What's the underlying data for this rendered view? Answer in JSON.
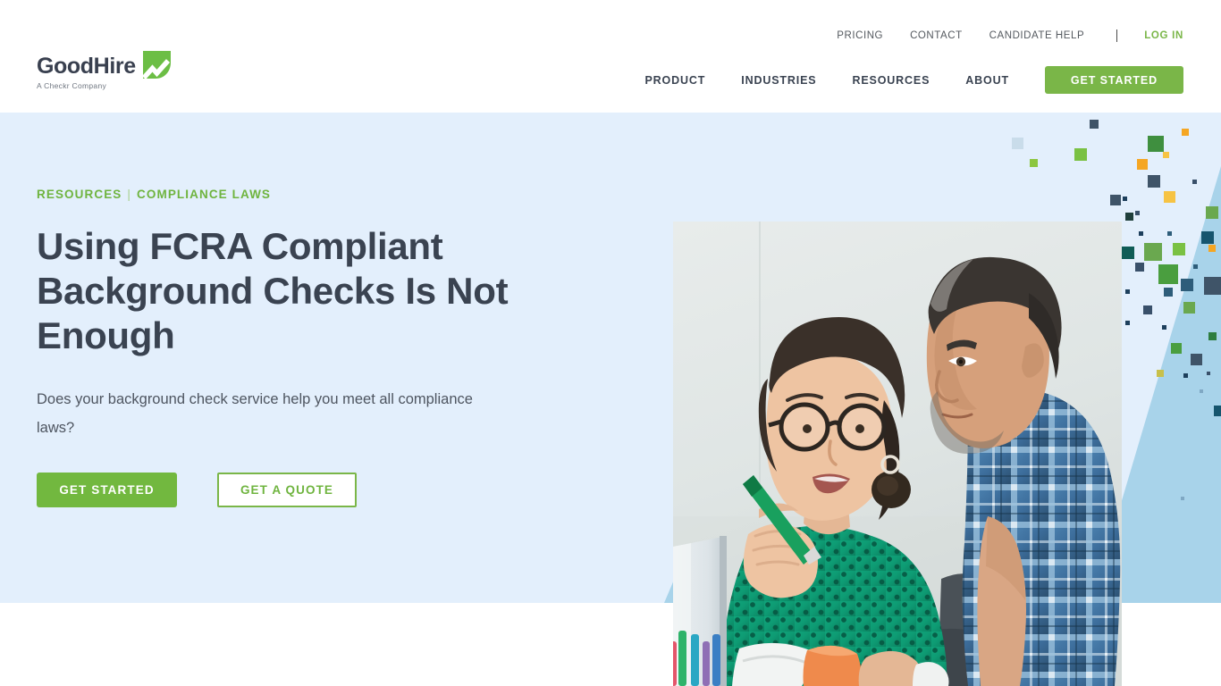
{
  "brand": {
    "name": "GoodHire",
    "tagline": "A Checkr Company",
    "logo_mark_icon": "goodhire-checkmark-icon",
    "accent_green": "#7ab648",
    "dark_navy": "#39404f"
  },
  "header": {
    "utility_nav": [
      {
        "label": "PRICING"
      },
      {
        "label": "CONTACT"
      },
      {
        "label": "CANDIDATE HELP"
      }
    ],
    "divider": "|",
    "login_label": "LOG IN",
    "main_nav": [
      {
        "label": "PRODUCT"
      },
      {
        "label": "INDUSTRIES"
      },
      {
        "label": "RESOURCES"
      },
      {
        "label": "ABOUT"
      }
    ],
    "cta_label": "GET STARTED"
  },
  "hero": {
    "background_color": "#e3effc",
    "breadcrumb": {
      "parent": "RESOURCES",
      "separator": "|",
      "current": "COMPLIANCE LAWS"
    },
    "title": "Using FCRA Compliant Background Checks Is Not Enough",
    "subtitle": "Does your background check service help you meet all compliance laws?",
    "primary_cta": "GET STARTED",
    "secondary_cta": "GET A QUOTE",
    "photo_alt": "Woman in green patterned blouse holding a green pen talking with a man in a blue plaid shirt looking at a computer monitor",
    "decor": {
      "wedge_color": "#a8d3ea",
      "square_colors": [
        "#4a9e3f",
        "#8cc63f",
        "#f5a623",
        "#f6c344",
        "#2e5d7a",
        "#1d3f5c",
        "#3f5468",
        "#c9dcea",
        "#0f5c56"
      ]
    }
  }
}
